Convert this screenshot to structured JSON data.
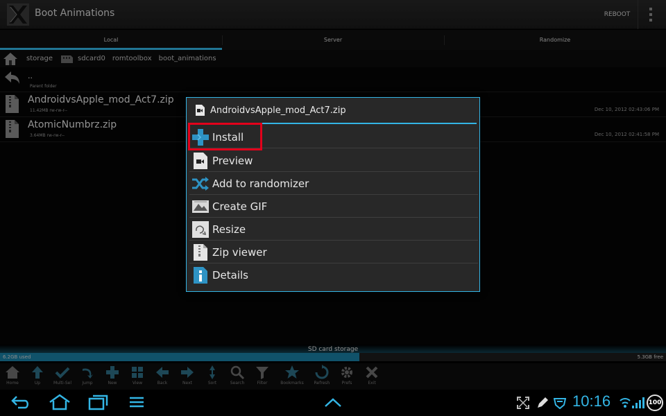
{
  "app": {
    "title": "Boot Animations",
    "reboot_label": "REBOOT"
  },
  "tabs": [
    {
      "label": "Local",
      "active": true
    },
    {
      "label": "Server",
      "active": false
    },
    {
      "label": "Randomize",
      "active": false
    }
  ],
  "breadcrumb": [
    "storage",
    "sdcard0",
    "romtoolbox",
    "boot_animations"
  ],
  "files": [
    {
      "name": "..",
      "meta": "Parent folder",
      "date": "",
      "icon": "back-arrow-icon"
    },
    {
      "name": "AndroidvsApple_mod_Act7.zip",
      "meta": "11.42MB rw-rw-r--",
      "date": "Dec 10, 2012 02:43:06 PM",
      "icon": "zip-file-icon"
    },
    {
      "name": "AtomicNumbrz.zip",
      "meta": "3.64MB rw-rw-r--",
      "date": "Dec 10, 2012 02:41:58 PM",
      "icon": "zip-file-icon"
    }
  ],
  "storage": {
    "label": "SD card storage",
    "used": "6.2GB used",
    "free": "5.3GB free",
    "used_fraction": 0.54
  },
  "toolbar": [
    "Home",
    "Up",
    "Multi-Sel",
    "Jump",
    "New",
    "View",
    "Back",
    "Next",
    "Sort",
    "Search",
    "Filter",
    "Bookmarks",
    "Refresh",
    "Prefs",
    "Exit"
  ],
  "dialog": {
    "title": "AndroidvsApple_mod_Act7.zip",
    "items": [
      {
        "label": "Install",
        "icon": "install-plus-icon",
        "highlighted": true
      },
      {
        "label": "Preview",
        "icon": "preview-video-icon",
        "highlighted": false
      },
      {
        "label": "Add to randomizer",
        "icon": "shuffle-icon",
        "highlighted": false
      },
      {
        "label": "Create GIF",
        "icon": "gif-image-icon",
        "highlighted": false
      },
      {
        "label": "Resize",
        "icon": "resize-icon",
        "highlighted": false
      },
      {
        "label": "Zip viewer",
        "icon": "zip-viewer-icon",
        "highlighted": false
      },
      {
        "label": "Details",
        "icon": "info-icon",
        "highlighted": false
      }
    ]
  },
  "status": {
    "time": "10:16",
    "battery": "100"
  },
  "colors": {
    "accent": "#33b5e5",
    "highlight": "#e3001b",
    "background": "#000000",
    "dialog": "#282828"
  }
}
